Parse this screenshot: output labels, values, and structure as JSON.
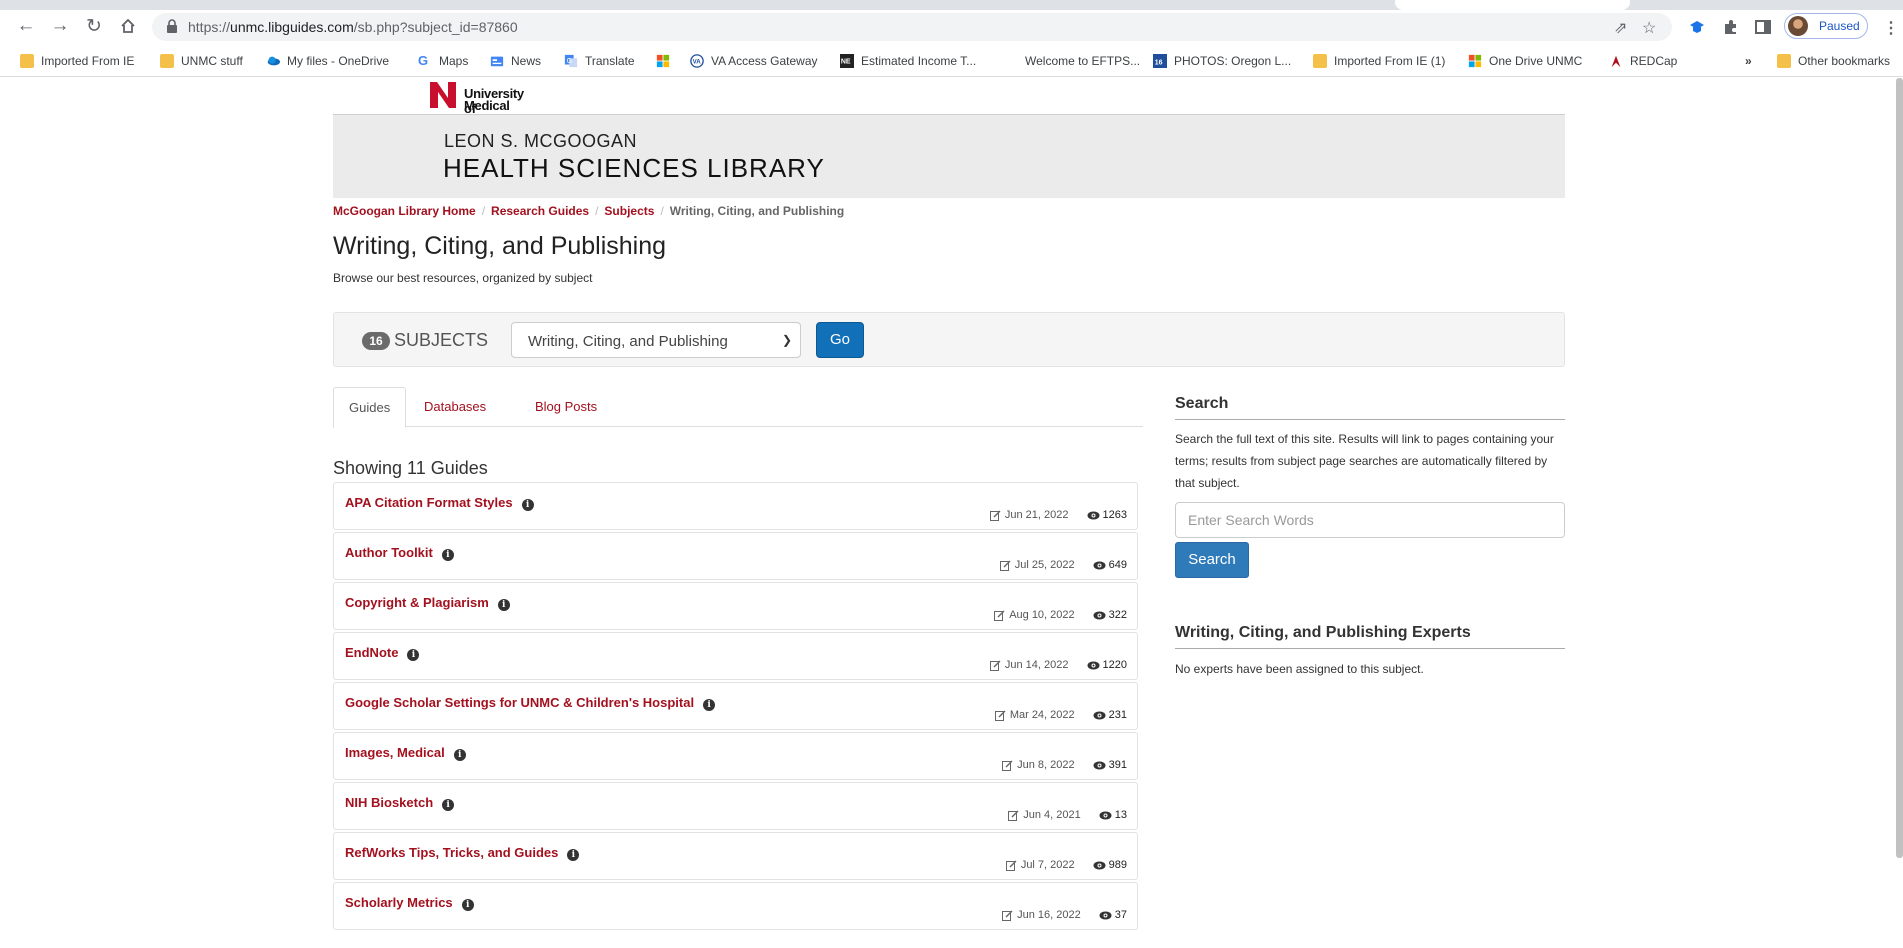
{
  "browser": {
    "url_prefix": "https://",
    "url_host": "unmc.libguides.com",
    "url_path": "/sb.php?subject_id=87860",
    "profile_label": "Paused",
    "more_bookmarks": "»",
    "bookmarks": [
      {
        "label": "Imported From IE",
        "icon": "folder-icon"
      },
      {
        "label": "UNMC stuff",
        "icon": "folder-icon"
      },
      {
        "label": "My files - OneDrive",
        "icon": "onedrive-icon"
      },
      {
        "label": "Maps",
        "icon": "google-maps-icon"
      },
      {
        "label": "News",
        "icon": "google-news-icon"
      },
      {
        "label": "Translate",
        "icon": "google-translate-icon"
      },
      {
        "label": "",
        "icon": "microsoft-icon"
      },
      {
        "label": "VA Access Gateway",
        "icon": "va-icon"
      },
      {
        "label": "Estimated Income T...",
        "icon": "ne-icon"
      },
      {
        "label": "Welcome to EFTPS...",
        "icon": "none"
      },
      {
        "label": "PHOTOS: Oregon L...",
        "icon": "news-site-icon"
      },
      {
        "label": "Imported From IE (1)",
        "icon": "folder-icon"
      },
      {
        "label": "One Drive UNMC",
        "icon": "microsoft-icon"
      },
      {
        "label": "REDCap",
        "icon": "redcap-icon"
      }
    ],
    "other_bookmarks": "Other bookmarks"
  },
  "logo": {
    "line1": "University of Nebraska",
    "line2": "Medical Center"
  },
  "banner": {
    "line1": "LEON S. MCGOOGAN",
    "line2": "HEALTH SCIENCES LIBRARY"
  },
  "breadcrumb": [
    "McGoogan Library Home",
    "Research Guides",
    "Subjects",
    "Writing, Citing, and Publishing"
  ],
  "page": {
    "title": "Writing, Citing, and Publishing",
    "subtitle": "Browse our best resources, organized by subject"
  },
  "subjects": {
    "count": "16",
    "label": "SUBJECTS",
    "selected": "Writing, Citing, and Publishing",
    "go_label": "Go"
  },
  "tabs": [
    "Guides",
    "Databases",
    "Blog Posts"
  ],
  "showing": "Showing 11 Guides",
  "guides": [
    {
      "name": "APA Citation Format Styles",
      "date": "Jun 21, 2022",
      "views": "1263"
    },
    {
      "name": "Author Toolkit",
      "date": "Jul 25, 2022",
      "views": "649"
    },
    {
      "name": "Copyright & Plagiarism",
      "date": "Aug 10, 2022",
      "views": "322"
    },
    {
      "name": "EndNote",
      "date": "Jun 14, 2022",
      "views": "1220"
    },
    {
      "name": "Google Scholar Settings for UNMC & Children's Hospital",
      "date": "Mar 24, 2022",
      "views": "231"
    },
    {
      "name": "Images, Medical",
      "date": "Jun 8, 2022",
      "views": "391"
    },
    {
      "name": "NIH Biosketch",
      "date": "Jun 4, 2021",
      "views": "13"
    },
    {
      "name": "RefWorks Tips, Tricks, and Guides",
      "date": "Jul 7, 2022",
      "views": "989"
    },
    {
      "name": "Scholarly Metrics",
      "date": "Jun 16, 2022",
      "views": "37"
    }
  ],
  "search": {
    "heading": "Search",
    "description": "Search the full text of this site. Results will link to pages containing your terms; results from subject page searches are automatically filtered by that subject.",
    "placeholder": "Enter Search Words",
    "button": "Search"
  },
  "experts": {
    "heading": "Writing, Citing, and Publishing Experts",
    "text": "No experts have been assigned to this subject."
  },
  "colors": {
    "brand_red": "#a3111f",
    "go_blue": "#1170b8",
    "search_blue": "#2f7ab9"
  }
}
